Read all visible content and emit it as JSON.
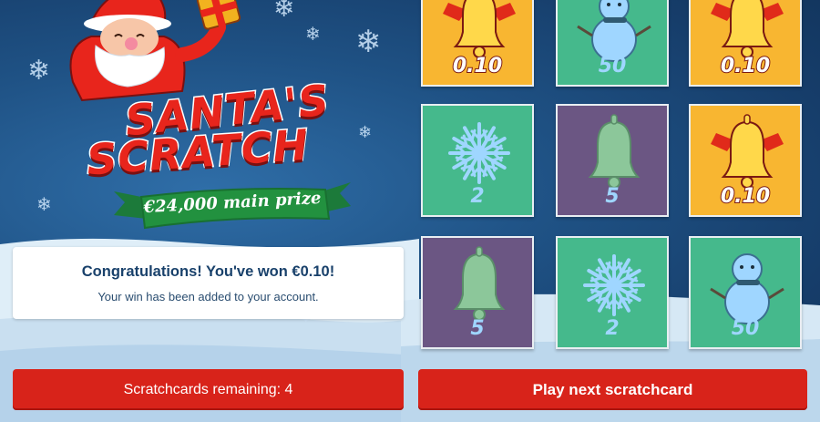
{
  "game": {
    "logo_line1": "SANTA'S",
    "logo_line2": "SCRATCH",
    "main_prize": "€24,000 main prize"
  },
  "message": {
    "title": "Congratulations! You've won €0.10!",
    "subtitle": "Your win has been added to your account."
  },
  "buttons": {
    "remaining_label": "Scratchcards remaining: 4",
    "play_label": "Play next scratchcard"
  },
  "cards": [
    {
      "symbol": "bell-icon",
      "value": "0.10",
      "color": "#f8b631"
    },
    {
      "symbol": "snowman-icon",
      "value": "50",
      "color": "#45b98c"
    },
    {
      "symbol": "bell-icon",
      "value": "0.10",
      "color": "#f8b631"
    },
    {
      "symbol": "snowflake-icon",
      "value": "2",
      "color": "#45b98c"
    },
    {
      "symbol": "bell-icon",
      "value": "5",
      "color": "#6b5683"
    },
    {
      "symbol": "bell-icon",
      "value": "0.10",
      "color": "#f8b631"
    },
    {
      "symbol": "bell-icon",
      "value": "5",
      "color": "#6b5683"
    },
    {
      "symbol": "snowflake-icon",
      "value": "2",
      "color": "#45b98c"
    },
    {
      "symbol": "snowman-icon",
      "value": "50",
      "color": "#45b98c"
    }
  ],
  "colors": {
    "button_red": "#d8231a",
    "card_yellow": "#f8b631",
    "card_green": "#45b98c",
    "card_purple": "#6b5683"
  }
}
